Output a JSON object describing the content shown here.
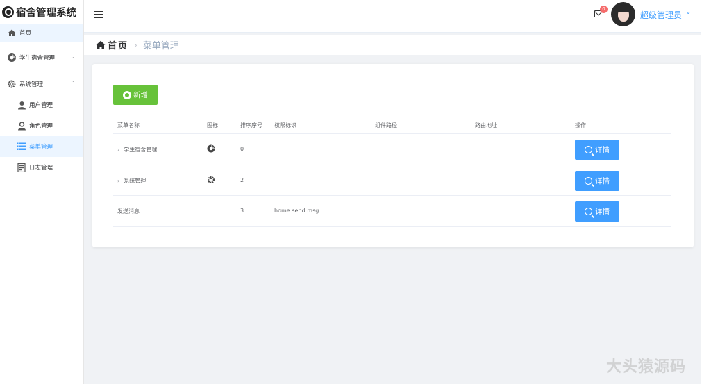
{
  "app": {
    "title": "宿舍管理系统"
  },
  "sidebar": {
    "items": [
      {
        "label": "首页",
        "icon": "home-icon"
      },
      {
        "label": "学生宿舍管理",
        "icon": "dorm-icon"
      },
      {
        "label": "系统管理",
        "icon": "gear-icon"
      },
      {
        "label": "用户管理",
        "icon": "user-icon"
      },
      {
        "label": "角色管理",
        "icon": "role-icon"
      },
      {
        "label": "菜单管理",
        "icon": "menu-list-icon"
      },
      {
        "label": "日志管理",
        "icon": "log-icon"
      }
    ]
  },
  "header": {
    "badge_count": "0",
    "user_name": "超级管理员"
  },
  "breadcrumb": {
    "home": "首页",
    "current": "菜单管理"
  },
  "main": {
    "add_button": "新增",
    "columns": [
      "菜单名称",
      "图标",
      "排序序号",
      "权限标识",
      "组件路径",
      "路由地址",
      "操作"
    ],
    "rows": [
      {
        "name": "学生宿舍管理",
        "icon": "dorm-icon",
        "order": "0",
        "perm": "",
        "path": "",
        "route": "",
        "expandable": true,
        "action": "详情"
      },
      {
        "name": "系统管理",
        "icon": "gear-icon",
        "order": "2",
        "perm": "",
        "path": "",
        "route": "",
        "expandable": true,
        "action": "详情"
      },
      {
        "name": "发送消息",
        "icon": "",
        "order": "3",
        "perm": "home:send:msg",
        "path": "",
        "route": "",
        "expandable": false,
        "action": "详情"
      }
    ]
  },
  "watermark": "大头猿源码",
  "colors": {
    "primary": "#409eff",
    "success": "#67c23a",
    "danger": "#f56c6c"
  }
}
